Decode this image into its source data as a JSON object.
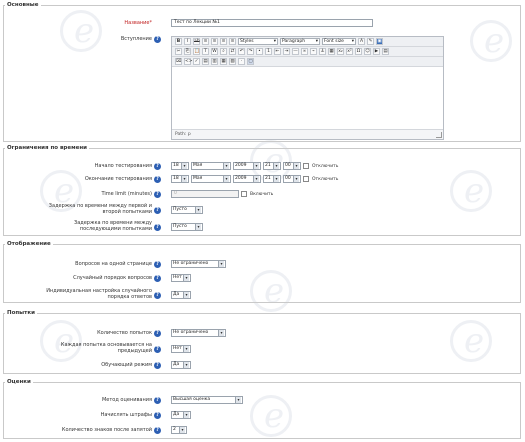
{
  "sections": {
    "general": "Основные",
    "timing": "Ограничения по времени",
    "display": "Отображение",
    "attempts": "Попытки",
    "grades": "Оценки"
  },
  "general": {
    "name_label": "Название*",
    "name_value": "Тест по Лекции №1",
    "intro_label": "Вступление",
    "editor": {
      "style_dd": "Styles",
      "para_dd": "Paragraph",
      "font_dd": "Font size",
      "status": "Path: p"
    }
  },
  "timing": {
    "open_label": "Начало тестирования",
    "close_label": "Окончание тестирования",
    "day": "18",
    "month": "Мая",
    "year": "2009",
    "hour": "21",
    "minute": "00",
    "disable": "Отключить",
    "timelimit_label": "Time limit (minutes)",
    "timelimit_value": "0",
    "enable": "Включить",
    "delay12_label": "Задержка по времени между первой и второй попытками",
    "delay12_value": "Пусто",
    "delay_later_label": "Задержка по времени между последующими попытками",
    "delay_later_value": "Пусто"
  },
  "display": {
    "per_page_label": "Вопросов на одной странице",
    "per_page_value": "Не ограничено",
    "shuffle_q_label": "Случайный порядок вопросов",
    "shuffle_q_value": "Нет",
    "shuffle_a_label": "Индивидуальная настройка случайного порядка ответов",
    "shuffle_a_value": "Да"
  },
  "attempts": {
    "count_label": "Количество попыток",
    "count_value": "Не ограничено",
    "build_label": "Каждая попытка основывается на предыдущей",
    "build_value": "Нет",
    "adaptive_label": "Обучающий режим",
    "adaptive_value": "Да"
  },
  "grades": {
    "method_label": "Метод оценивания",
    "method_value": "Высшая оценка",
    "penalty_label": "Начислять штрафы",
    "penalty_value": "Да",
    "decimals_label": "Количество знаков после запятой",
    "decimals_value": "2"
  }
}
